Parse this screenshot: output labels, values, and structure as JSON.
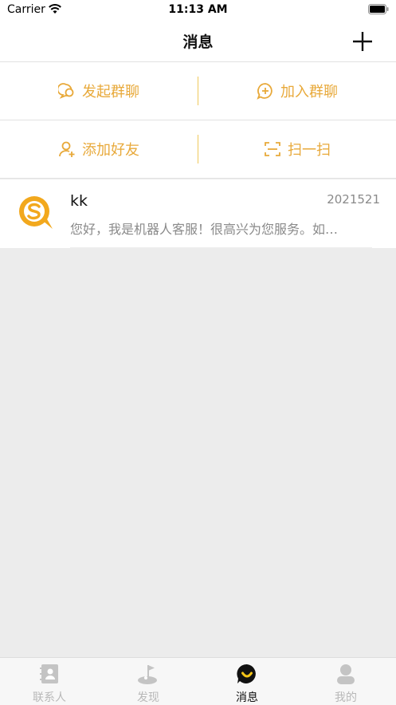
{
  "status_bar": {
    "carrier": "Carrier",
    "time": "11:13 AM"
  },
  "nav": {
    "title": "消息"
  },
  "actions": {
    "start_group_chat": "发起群聊",
    "join_group_chat": "加入群聊",
    "add_friend": "添加好友",
    "scan": "扫一扫"
  },
  "chats": [
    {
      "name": "kk",
      "date": "2021521",
      "preview": "您好，我是机器人客服！很高兴为您服务。如…"
    }
  ],
  "tabs": [
    {
      "label": "联系人",
      "icon": "contacts-icon"
    },
    {
      "label": "发现",
      "icon": "discover-icon"
    },
    {
      "label": "消息",
      "icon": "messages-icon",
      "active": true
    },
    {
      "label": "我的",
      "icon": "profile-icon"
    }
  ],
  "colors": {
    "accent": "#E8A93A",
    "background": "#ECECEC",
    "active_tab": "#111111",
    "inactive_tab": "#B8B8B8"
  }
}
